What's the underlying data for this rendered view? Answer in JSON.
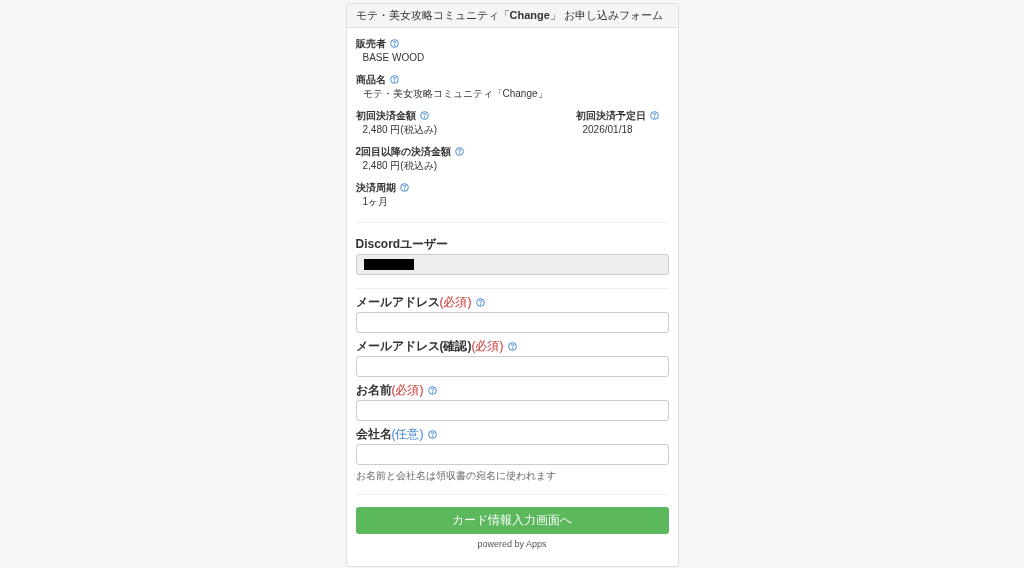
{
  "header": {
    "title": "モテ・美女攻略コミュニティ「**Change**」 お申し込みフォーム"
  },
  "info_rows": [
    {
      "items": [
        {
          "label": "販売者",
          "value": "BASE WOOD"
        }
      ]
    },
    {
      "items": [
        {
          "label": "商品名",
          "value": "モテ・美女攻略コミュニティ「Change」"
        }
      ]
    },
    {
      "items": [
        {
          "label": "初回決済金額",
          "value": "2,480 円(税込み)"
        },
        {
          "label": "初回決済予定日",
          "value": "2026/01/18"
        }
      ]
    },
    {
      "items": [
        {
          "label": "2回目以降の決済金額",
          "value": "2,480 円(税込み)"
        }
      ]
    },
    {
      "items": [
        {
          "label": "決済周期",
          "value": "1ヶ月"
        }
      ]
    }
  ],
  "discord": {
    "label": "Discordユーザー",
    "disabled": true,
    "redacted": true
  },
  "fields": [
    {
      "label": "メールアドレス",
      "tag": "(必須)",
      "kind": "required"
    },
    {
      "label": "メールアドレス(確認)",
      "tag": "(必須)",
      "kind": "required"
    },
    {
      "label": "お名前",
      "tag": "(必須)",
      "kind": "required"
    },
    {
      "label": "会社名",
      "tag": "(任意)",
      "kind": "optional"
    }
  ],
  "note": "お名前と会社名は領収書の宛名に使われます",
  "submit_button": "カード情報入力画面へ",
  "footer": "powered by Apps"
}
